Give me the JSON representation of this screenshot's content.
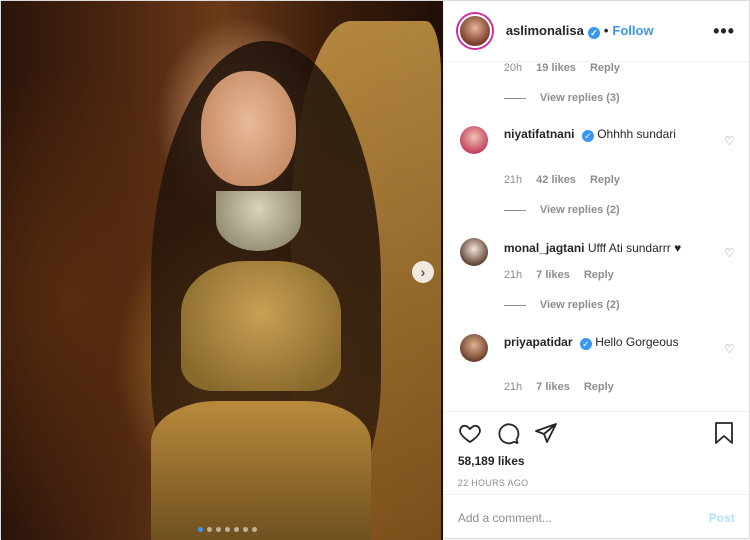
{
  "header": {
    "username": "aslimonalisa",
    "verified": true,
    "separator": "•",
    "follow_label": "Follow",
    "more_icon": "more-horizontal-icon"
  },
  "thread_top": {
    "time": "20h",
    "likes": "19 likes",
    "reply": "Reply",
    "view_replies": "View replies (3)"
  },
  "comments": [
    {
      "username": "niyatifatnani",
      "verified": true,
      "text": "Ohhhh sundari",
      "text_line2": "",
      "time": "21h",
      "likes": "42 likes",
      "reply": "Reply",
      "view_replies": "View replies (2)"
    },
    {
      "username": "monal_jagtani",
      "verified": false,
      "text": "Ufff Ati sundarrr ♥",
      "time": "21h",
      "likes": "7 likes",
      "reply": "Reply",
      "view_replies": "View replies (2)"
    },
    {
      "username": "priyapatidar",
      "verified": true,
      "text": "Hello Gorgeous",
      "text_line2": "",
      "time": "21h",
      "likes": "7 likes",
      "reply": "Reply"
    }
  ],
  "actions": {
    "like_icon": "heart-icon",
    "comment_icon": "comment-icon",
    "share_icon": "share-icon",
    "save_icon": "bookmark-icon",
    "likes_count": "58,189 likes",
    "timestamp": "22 HOURS AGO"
  },
  "add_comment": {
    "placeholder": "Add a comment...",
    "post_label": "Post"
  },
  "carousel": {
    "next_icon": "chevron-right-icon",
    "slide_count": 7,
    "active_index": 0
  },
  "colors": {
    "accent": "#3897f0",
    "muted": "#8e8e8e",
    "post_disabled": "#b2dffc"
  }
}
